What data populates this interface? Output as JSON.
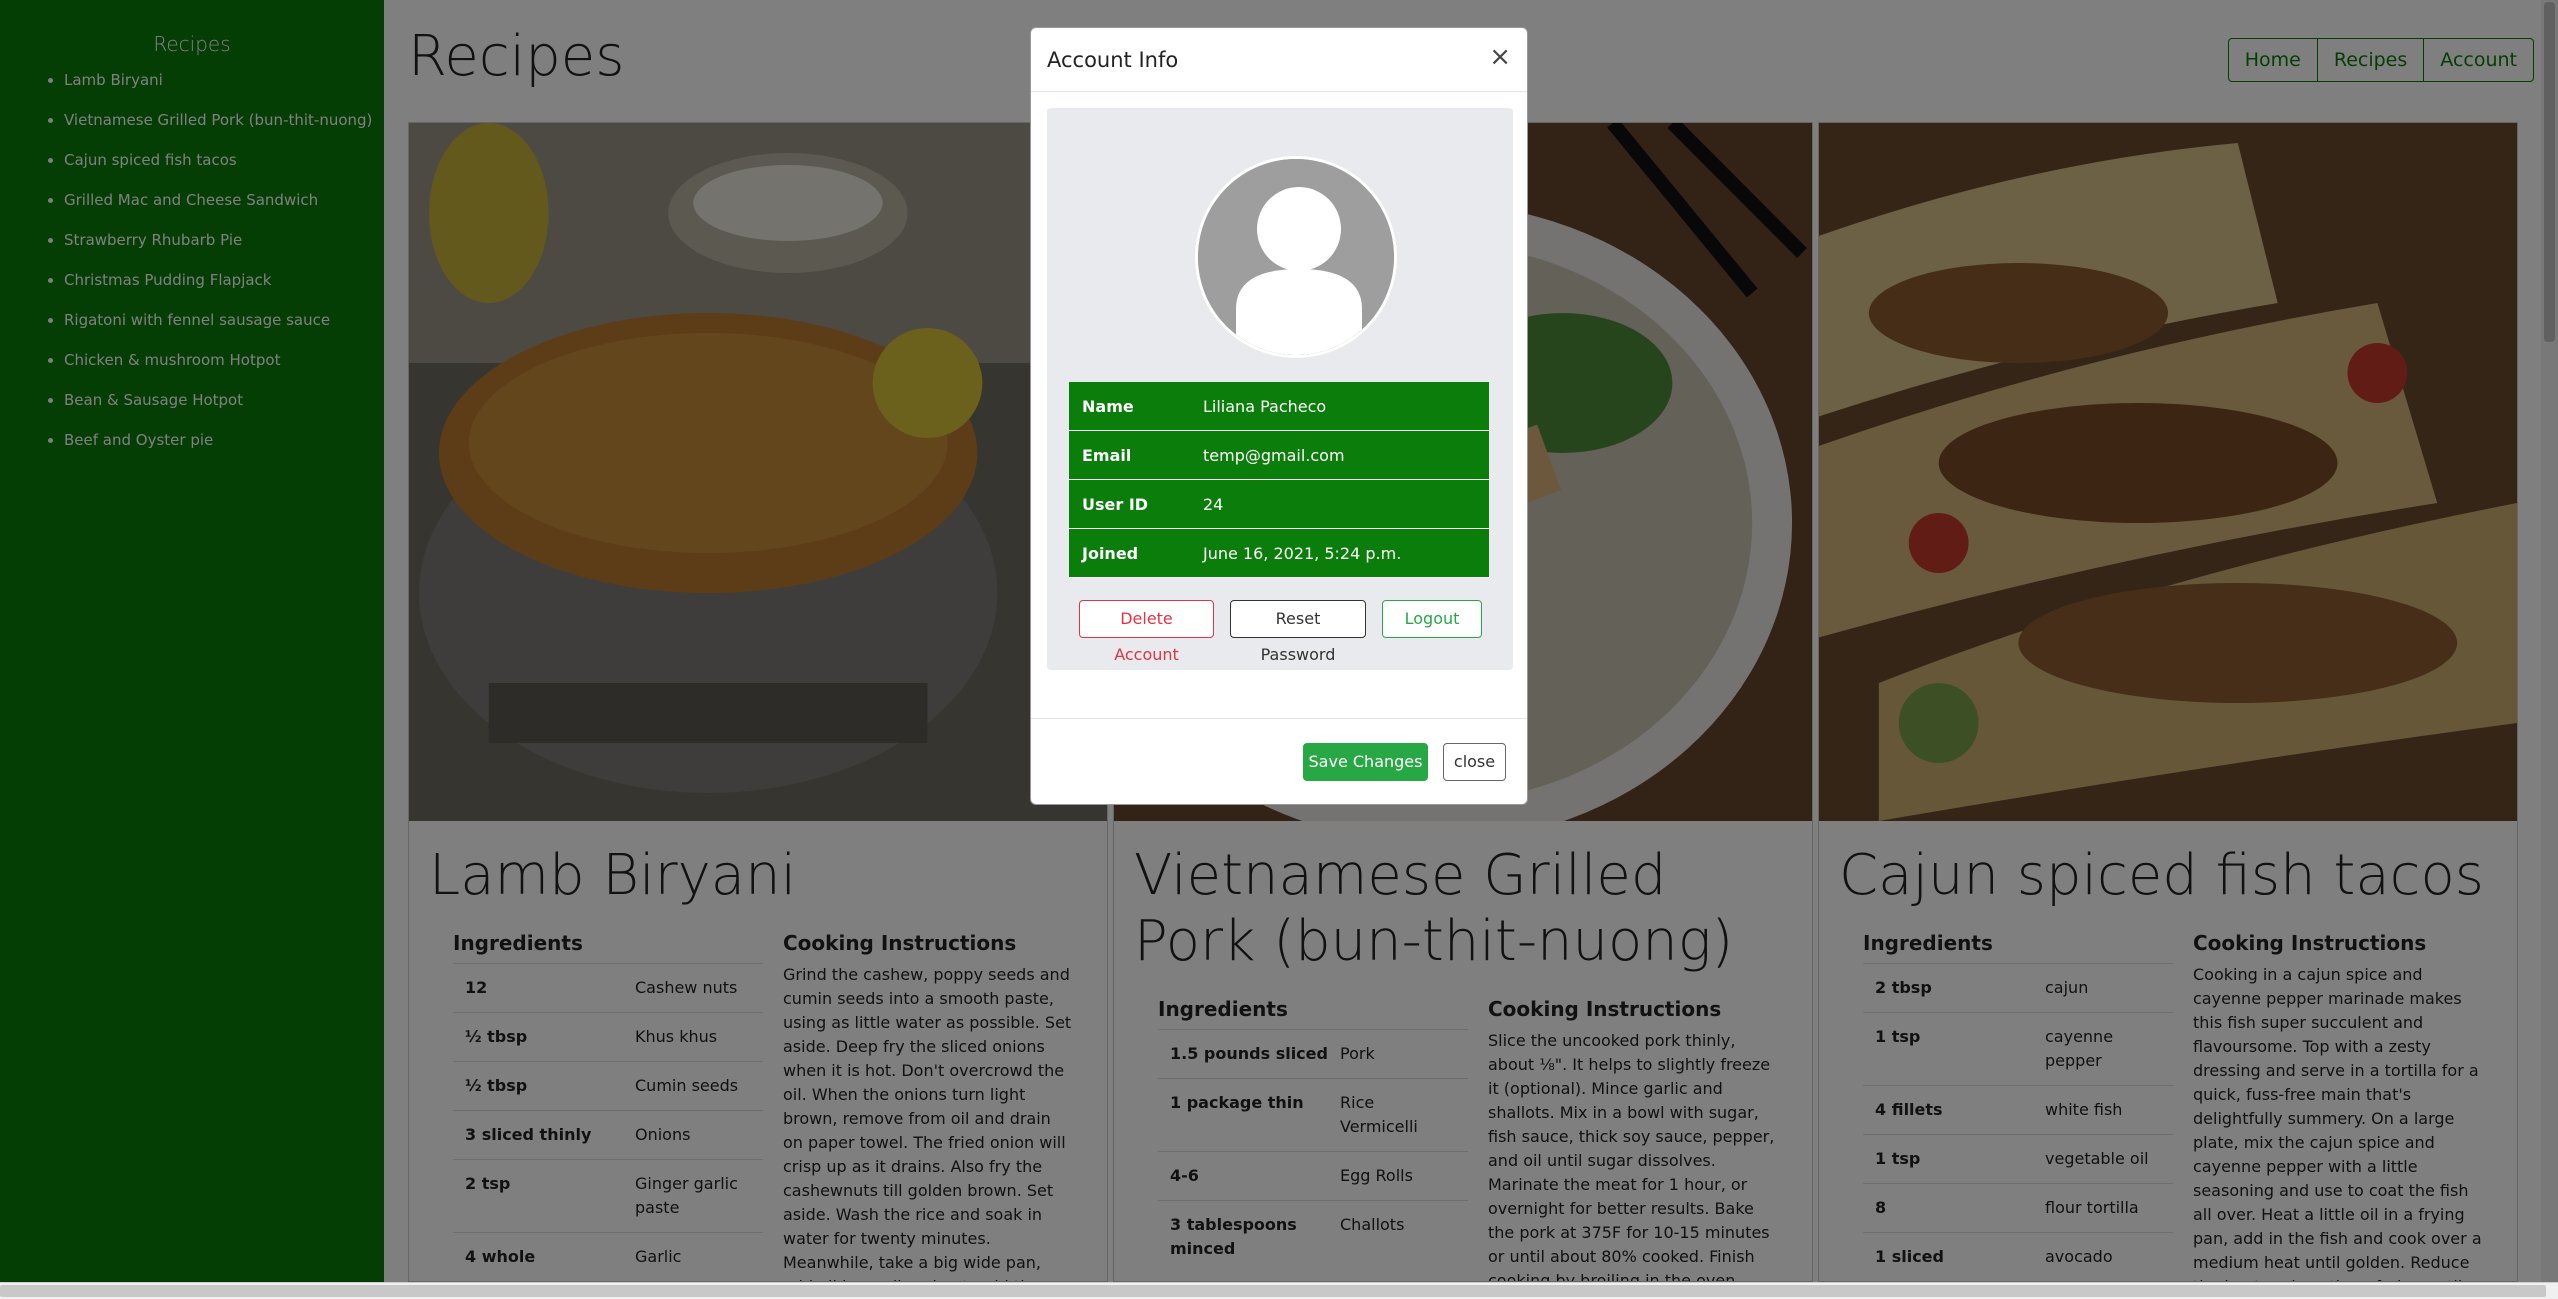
{
  "sidebar": {
    "title": "Recipes",
    "items": [
      "Lamb Biryani",
      "Vietnamese Grilled Pork (bun-thit-nuong)",
      "Cajun spiced fish tacos",
      "Grilled Mac and Cheese Sandwich",
      "Strawberry Rhubarb Pie",
      "Christmas Pudding Flapjack",
      "Rigatoni with fennel sausage sauce",
      "Chicken & mushroom Hotpot",
      "Bean & Sausage Hotpot",
      "Beef and Oyster pie"
    ]
  },
  "header": {
    "title": "Recipes",
    "nav": [
      "Home",
      "Recipes",
      "Account"
    ]
  },
  "cards": [
    {
      "title": "Lamb Biryani",
      "ingredients_label": "Ingredients",
      "instructions_label": "Cooking Instructions",
      "ingredients": [
        {
          "q": "12",
          "n": "Cashew nuts"
        },
        {
          "q": "½ tbsp",
          "n": "Khus khus"
        },
        {
          "q": "½ tbsp",
          "n": "Cumin seeds"
        },
        {
          "q": "3 sliced thinly",
          "n": "Onions"
        },
        {
          "q": "2 tsp",
          "n": "Ginger garlic paste"
        },
        {
          "q": "4 whole",
          "n": "Garlic"
        }
      ],
      "instructions": "Grind the cashew, poppy seeds and cumin seeds into a smooth paste, using as little water as possible. Set aside. Deep fry the sliced onions when it is hot. Don't overcrowd the oil. When the onions turn light brown, remove from oil and drain on paper towel. The fried onion will crisp up as it drains. Also fry the cashewnuts till golden brown. Set aside. Wash the rice and soak in water for twenty minutes. Meanwhile, take a big wide pan, add oil in medium heat, add the sliced onions, add the blended"
    },
    {
      "title": "Vietnamese Grilled Pork (bun-thit-nuong)",
      "ingredients_label": "Ingredients",
      "instructions_label": "Cooking Instructions",
      "ingredients": [
        {
          "q": "1.5 pounds sliced",
          "n": "Pork"
        },
        {
          "q": "1 package thin",
          "n": "Rice Vermicelli"
        },
        {
          "q": "4-6",
          "n": "Egg Rolls"
        },
        {
          "q": "3 tablespoons minced",
          "n": "Challots"
        }
      ],
      "instructions": "Slice the uncooked pork thinly, about ⅛\". It helps to slightly freeze it (optional). Mince garlic and shallots. Mix in a bowl with sugar, fish sauce, thick soy sauce, pepper, and oil until sugar dissolves. Marinate the meat for 1 hour, or overnight for better results. Bake the pork at 375F for 10-15 minutes or until about 80% cooked. Finish cooking by broiling in the oven"
    },
    {
      "title": "Cajun spiced fish tacos",
      "ingredients_label": "Ingredients",
      "instructions_label": "Cooking Instructions",
      "ingredients": [
        {
          "q": "2 tbsp",
          "n": "cajun"
        },
        {
          "q": "1 tsp",
          "n": "cayenne pepper"
        },
        {
          "q": "4 fillets",
          "n": "white fish"
        },
        {
          "q": "1 tsp",
          "n": "vegetable oil"
        },
        {
          "q": "8",
          "n": "flour tortilla"
        },
        {
          "q": "1 sliced",
          "n": "avocado"
        }
      ],
      "instructions": "Cooking in a cajun spice and cayenne pepper marinade makes this fish super succulent and flavoursome. Top with a zesty dressing and serve in a tortilla for a quick, fuss-free main that's delightfully summery. On a large plate, mix the cajun spice and cayenne pepper with a little seasoning and use to coat the fish all over. Heat a little oil in a frying pan, add in the fish and cook over a medium heat until golden. Reduce the heat and continue frying until the fish is cooked through, about"
    }
  ],
  "modal": {
    "title": "Account Info",
    "close_glyph": "×",
    "fields": [
      {
        "label": "Name",
        "value": "Liliana Pacheco"
      },
      {
        "label": "Email",
        "value": "temp@gmail.com"
      },
      {
        "label": "User ID",
        "value": "24"
      },
      {
        "label": "Joined",
        "value": "June 16, 2021, 5:24 p.m."
      }
    ],
    "delete_label": "Delete Account",
    "reset_label": "Reset Password",
    "logout_label": "Logout",
    "save_label": "Save Changes",
    "close_label": "close"
  },
  "colors": {
    "brand_green": "#0a7d0a",
    "success": "#28a745",
    "danger": "#dc3545",
    "overlay": "rgba(0,0,0,0.5)"
  }
}
